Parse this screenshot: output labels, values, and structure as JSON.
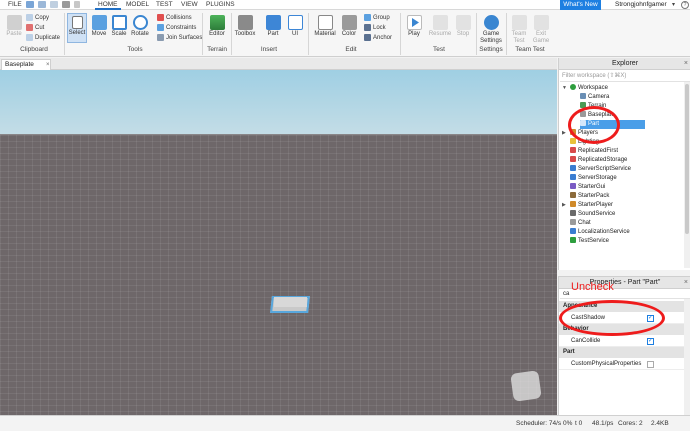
{
  "menubar": {
    "file": "FILE",
    "tabs": [
      "HOME",
      "MODEL",
      "TEST",
      "VIEW",
      "PLUGINS"
    ],
    "whats_new": "What's New",
    "username": "Strongjohnfgamer",
    "caret": "▾",
    "help": "?"
  },
  "ribbon": {
    "paste": "Paste",
    "copy": "Copy",
    "cut": "Cut",
    "duplicate": "Duplicate",
    "clipboard_group": "Clipboard",
    "select": "Select",
    "move": "Move",
    "scale": "Scale",
    "rotate": "Rotate",
    "collisions": "Collisions",
    "constraints": "Constraints",
    "join_surfaces": "Join Surfaces",
    "tools_group": "Tools",
    "editor": "Editor",
    "terrain_group": "Terrain",
    "toolbox": "Toolbox",
    "part": "Part",
    "ui": "UI",
    "insert_group": "Insert",
    "material": "Material",
    "color": "Color",
    "group": "Group",
    "lock": "Lock",
    "anchor": "Anchor",
    "edit_group": "Edit",
    "play": "Play",
    "resume": "Resume",
    "stop": "Stop",
    "test_group": "Test",
    "game_settings_1": "Game",
    "game_settings_2": "Settings",
    "settings_group": "Settings",
    "team_test_1": "Team",
    "team_test_2": "Test",
    "exit_game_1": "Exit",
    "exit_game_2": "Game",
    "team_test_group": "Team Test"
  },
  "viewport": {
    "tab_label": "Baseplate",
    "tab_close": "×"
  },
  "explorer": {
    "title": "Explorer",
    "close": "×",
    "filter_placeholder": "Filter workspace (⇧⌘X)",
    "items": [
      {
        "label": "Workspace",
        "color": "#2e9e3e"
      },
      {
        "label": "Camera",
        "color": "#6a8fb5"
      },
      {
        "label": "Terrain",
        "color": "#4b9b55"
      },
      {
        "label": "Baseplate",
        "color": "#9a9a9a"
      },
      {
        "label": "Part",
        "color": "#9a9a9a"
      },
      {
        "label": "Players",
        "color": "#d08a2a"
      },
      {
        "label": "Lighting",
        "color": "#e8c23a"
      },
      {
        "label": "ReplicatedFirst",
        "color": "#d94a4a"
      },
      {
        "label": "ReplicatedStorage",
        "color": "#d94a4a"
      },
      {
        "label": "ServerScriptService",
        "color": "#3a7dd1"
      },
      {
        "label": "ServerStorage",
        "color": "#3a7dd1"
      },
      {
        "label": "StarterGui",
        "color": "#7a5bc4"
      },
      {
        "label": "StarterPack",
        "color": "#8b6a3a"
      },
      {
        "label": "StarterPlayer",
        "color": "#d08a2a"
      },
      {
        "label": "SoundService",
        "color": "#6a6a6a"
      },
      {
        "label": "Chat",
        "color": "#9a9a9a"
      },
      {
        "label": "LocalizationService",
        "color": "#3a7dd1"
      },
      {
        "label": "TestService",
        "color": "#2e9e3e"
      }
    ]
  },
  "properties": {
    "title": "Properties - Part \"Part\"",
    "close": "×",
    "filter_value": "ca",
    "categories": {
      "appearance": "Appearance",
      "behavior": "Behavior",
      "part": "Part"
    },
    "rows": {
      "cast_shadow": {
        "label": "CastShadow",
        "checked": true
      },
      "can_collide": {
        "label": "CanCollide",
        "checked": true
      },
      "custom_physical": {
        "label": "CustomPhysicalProperties",
        "checked": false
      }
    },
    "check_mark": "✓"
  },
  "annotation": {
    "text": "Uncheck"
  },
  "statusbar": {
    "scheduler": "Scheduler: 74/s 0%",
    "t": "t 0",
    "kbs": "48.1/ps",
    "cores": "Cores: 2",
    "mem": "2.4KB"
  },
  "colors": {
    "accent": "#1d7fe1",
    "selection": "#4a9ee8",
    "annotation": "#ee1c1c"
  }
}
